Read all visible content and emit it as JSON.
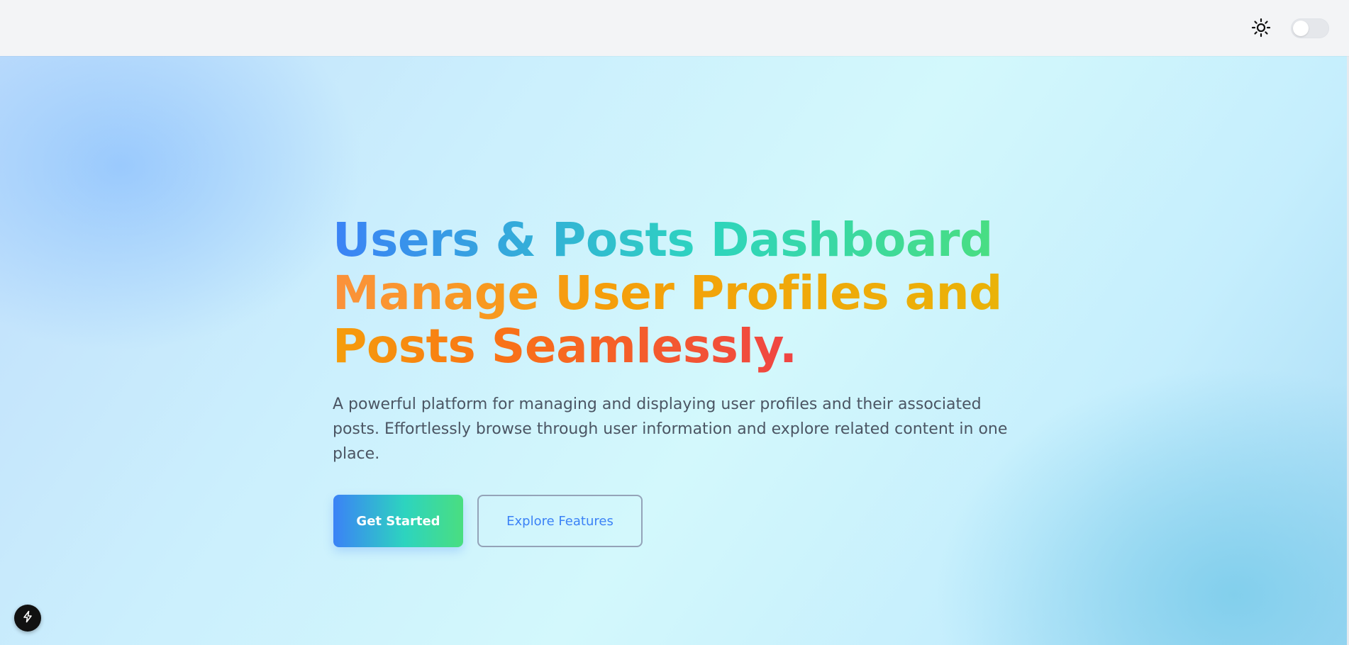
{
  "header": {
    "theme_icon": "sun-icon",
    "theme_toggle_on": false
  },
  "hero": {
    "title_line1": "Users & Posts Dashboard",
    "title_line2": "Manage User Profiles and",
    "title_line3": "Posts Seamlessly.",
    "description": "A powerful platform for managing and displaying user profiles and their associated posts. Effortlessly browse through user information and explore related content in one place.",
    "primary_button": "Get Started",
    "secondary_button": "Explore Features"
  },
  "floating_button": {
    "icon": "lightning-icon"
  },
  "colors": {
    "gradient_blue": "#3b82f6",
    "gradient_teal": "#2dd4bf",
    "gradient_green": "#4ade80",
    "gradient_orange": "#f97316",
    "gradient_amber": "#eab308",
    "gradient_red": "#ef4444",
    "description_text": "#4b5563",
    "secondary_text": "#3b82f6"
  }
}
